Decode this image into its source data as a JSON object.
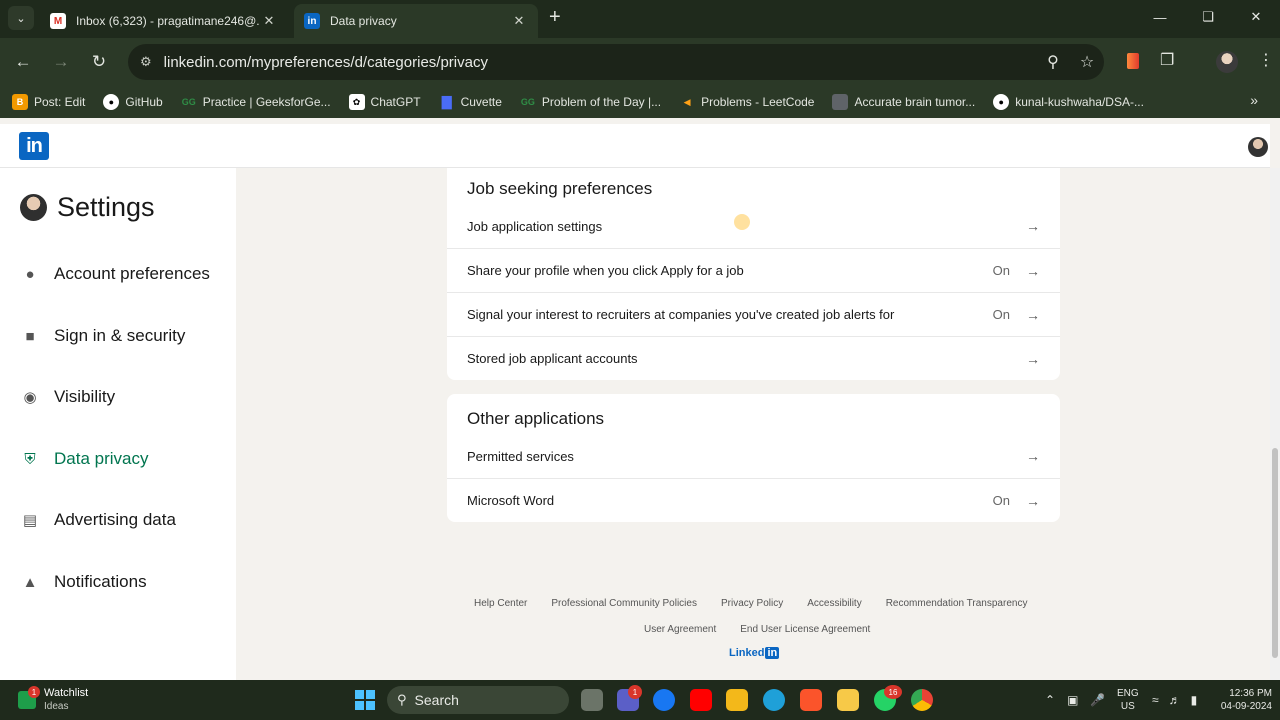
{
  "browser": {
    "tabs": [
      {
        "title": "Inbox (6,323) - pragatimane246@...",
        "favicon": "gmail-icon"
      },
      {
        "title": "Data privacy",
        "favicon": "linkedin-icon"
      }
    ],
    "url": "linkedin.com/mypreferences/d/categories/privacy",
    "bookmarks": [
      {
        "label": "Post: Edit",
        "color": "#f29900"
      },
      {
        "label": "GitHub",
        "color": "#ffffff"
      },
      {
        "label": "Practice | GeeksforGe...",
        "color": "#2f8d46"
      },
      {
        "label": "ChatGPT",
        "color": "#ffffff"
      },
      {
        "label": "Cuvette",
        "color": "#4a6cf7"
      },
      {
        "label": "Problem of the Day |...",
        "color": "#2f8d46"
      },
      {
        "label": "Problems - LeetCode",
        "color": "#ffa116"
      },
      {
        "label": "Accurate brain tumor...",
        "color": "#5f6368"
      },
      {
        "label": "kunal-kushwaha/DSA-...",
        "color": "#ffffff"
      }
    ]
  },
  "sidebar": {
    "title": "Settings",
    "items": [
      {
        "label": "Account preferences",
        "icon": "person-icon"
      },
      {
        "label": "Sign in & security",
        "icon": "lock-icon"
      },
      {
        "label": "Visibility",
        "icon": "eye-icon"
      },
      {
        "label": "Data privacy",
        "icon": "shield-icon",
        "active": true
      },
      {
        "label": "Advertising data",
        "icon": "ad-icon"
      },
      {
        "label": "Notifications",
        "icon": "bell-icon"
      }
    ]
  },
  "sections": {
    "job_seeking": {
      "title": "Job seeking preferences",
      "rows": [
        {
          "label": "Job application settings",
          "status": ""
        },
        {
          "label": "Share your profile when you click Apply for a job",
          "status": "On"
        },
        {
          "label": "Signal your interest to recruiters at companies you've created job alerts for",
          "status": "On"
        },
        {
          "label": "Stored job applicant accounts",
          "status": ""
        }
      ]
    },
    "other_apps": {
      "title": "Other applications",
      "rows": [
        {
          "label": "Permitted services",
          "status": ""
        },
        {
          "label": "Microsoft Word",
          "status": "On"
        }
      ]
    }
  },
  "footer": {
    "links_row1": [
      "Help Center",
      "Professional Community Policies",
      "Privacy Policy",
      "Accessibility",
      "Recommendation Transparency"
    ],
    "links_row2": [
      "User Agreement",
      "End User License Agreement"
    ],
    "logo_text": "Linked",
    "logo_in": "in"
  },
  "taskbar": {
    "watchlist_title": "Watchlist",
    "watchlist_sub": "Ideas",
    "watchlist_badge": "1",
    "search_label": "Search",
    "teams_badge": "1",
    "whatsapp_badge": "16",
    "lang_1": "ENG",
    "lang_2": "US",
    "time": "12:36 PM",
    "date": "04-09-2024"
  },
  "colors": {
    "linkedin_blue": "#0a66c2",
    "active_green": "#01754f",
    "chrome_dark": "#2b3927"
  }
}
